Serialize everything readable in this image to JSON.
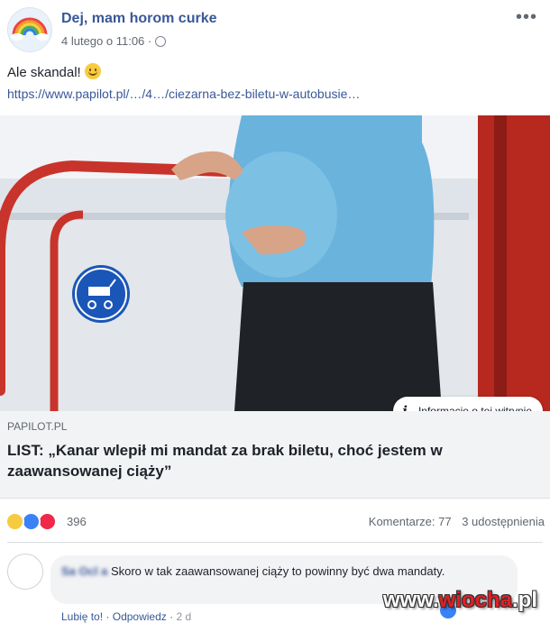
{
  "post": {
    "author": "Dej, mam horom curke",
    "timestamp": "4 lutego o 11:06 ·",
    "text": "Ale skandal!",
    "link": "https://www.papilot.pl/…/4…/ciezarna-bez-biletu-w-autobusie…",
    "more_label": "•••"
  },
  "link_preview": {
    "info_label": "Informacje o tej witrynie",
    "domain": "PAPILOT.PL",
    "headline": "LIST: „Kanar wlepił mi mandat za brak biletu, choć jestem w zaawansowanej ciąży”"
  },
  "stats": {
    "reactions": "396",
    "comments": "Komentarze: 77",
    "shares": "3 udostępnienia"
  },
  "comment": {
    "author": "Sa   Ocl   a",
    "text": "Skoro w tak zaawansowanej ciąży to powinny być dwa mandaty.",
    "like": "Lubię to!",
    "reply": "Odpowiedz",
    "time": "2 d"
  },
  "watermark": {
    "left": "www.",
    "brand": "wiocha",
    "right": ".pl"
  },
  "colors": {
    "link_blue": "#385898",
    "preview_bg": "#f2f3f5",
    "shirt": "#6ab3dd",
    "handrail": "#c8342b"
  }
}
